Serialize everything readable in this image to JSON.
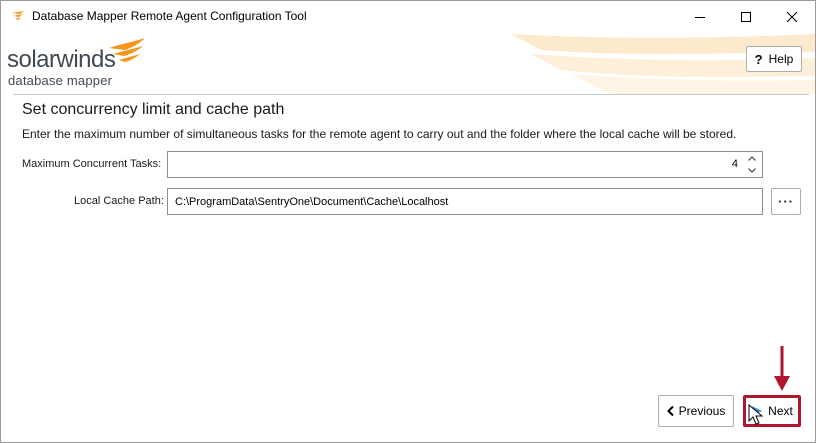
{
  "window": {
    "title": "Database Mapper Remote Agent Configuration Tool",
    "controls": {
      "minimize": "minimize-icon",
      "maximize": "maximize-icon",
      "close": "close-icon"
    }
  },
  "header": {
    "logo_word": "solarwinds",
    "logo_subtitle": "database mapper",
    "help_glyph": "?",
    "help_label": "Help",
    "accent_color": "#f7941d"
  },
  "page": {
    "title": "Set concurrency limit and cache path",
    "description": "Enter the maximum number of simultaneous tasks for the remote agent to carry out and the folder where the local cache will be stored."
  },
  "form": {
    "max_tasks_label": "Maximum Concurrent Tasks:",
    "max_tasks_value": "4",
    "cache_path_label": "Local Cache Path:",
    "cache_path_value": "C:\\ProgramData\\SentryOne\\Document\\Cache\\Localhost",
    "browse_label": "···"
  },
  "footer": {
    "previous_label": "Previous",
    "next_label": "Next",
    "highlight_color": "#b0172f"
  }
}
